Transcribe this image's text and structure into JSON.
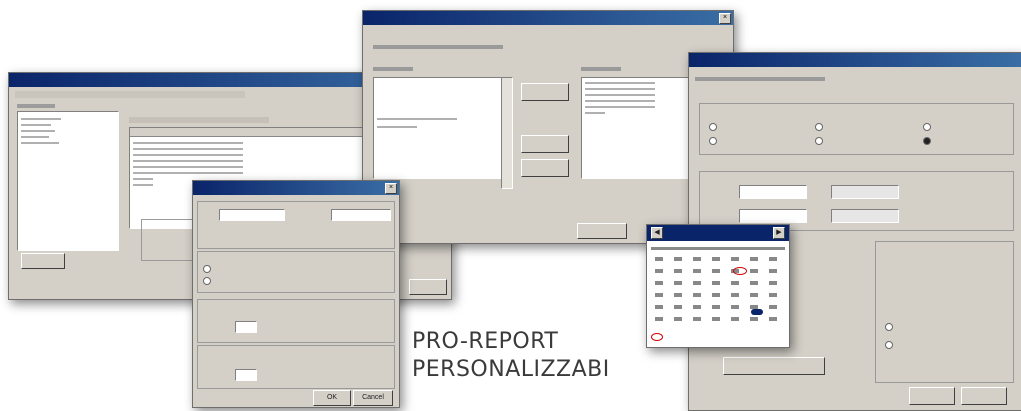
{
  "caption": {
    "line1": "PRO-REPORT",
    "line2": "PERSONALIZZABI"
  },
  "dialog_ok": "OK",
  "dialog_cancel": "Cancel",
  "colors": {
    "titlebar": "#0a246a",
    "window_face": "#d4d0c8",
    "calendar_mark": "#d00000"
  }
}
